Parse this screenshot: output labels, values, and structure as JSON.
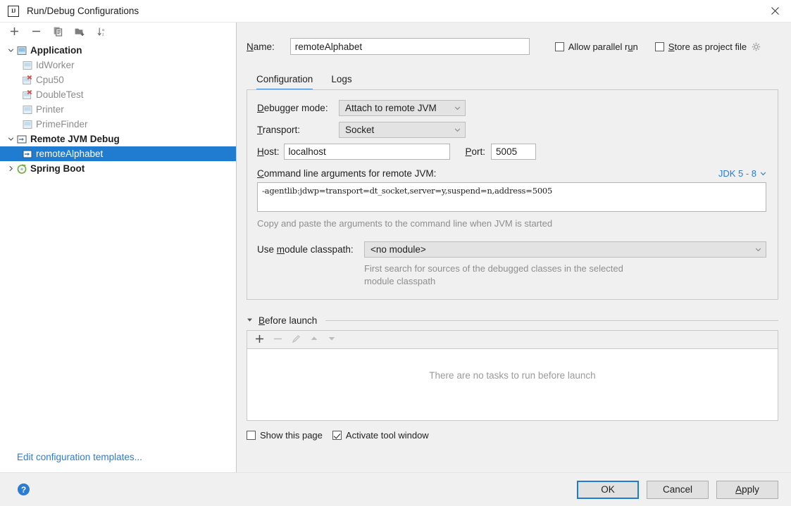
{
  "window": {
    "title": "Run/Debug Configurations",
    "app_icon": "IJ",
    "close_icon": "close-icon"
  },
  "tree_toolbar": {
    "items": [
      {
        "name": "add-configuration",
        "icon": "plus-icon"
      },
      {
        "name": "remove-configuration",
        "icon": "minus-icon"
      },
      {
        "name": "copy-configuration",
        "icon": "copy-icon"
      },
      {
        "name": "save-configuration",
        "icon": "folder-add-icon"
      },
      {
        "name": "sort-configurations",
        "icon": "sort-alpha-icon"
      }
    ]
  },
  "tree": {
    "nodes": [
      {
        "label": "Application",
        "level": 0,
        "bold": true,
        "muted": false,
        "selected": false,
        "expander": "expanded",
        "icon": "application-icon"
      },
      {
        "label": "IdWorker",
        "level": 1,
        "bold": false,
        "muted": true,
        "selected": false,
        "expander": "none",
        "icon": "application-icon"
      },
      {
        "label": "Cpu50",
        "level": 1,
        "bold": false,
        "muted": true,
        "selected": false,
        "expander": "none",
        "icon": "application-error-icon"
      },
      {
        "label": "DoubleTest",
        "level": 1,
        "bold": false,
        "muted": true,
        "selected": false,
        "expander": "none",
        "icon": "application-error-icon"
      },
      {
        "label": "Printer",
        "level": 1,
        "bold": false,
        "muted": true,
        "selected": false,
        "expander": "none",
        "icon": "application-icon"
      },
      {
        "label": "PrimeFinder",
        "level": 1,
        "bold": false,
        "muted": true,
        "selected": false,
        "expander": "none",
        "icon": "application-icon"
      },
      {
        "label": "Remote JVM Debug",
        "level": 0,
        "bold": true,
        "muted": false,
        "selected": false,
        "expander": "expanded",
        "icon": "remote-debug-icon"
      },
      {
        "label": "remoteAlphabet",
        "level": 1,
        "bold": false,
        "muted": false,
        "selected": true,
        "expander": "none",
        "icon": "remote-debug-icon"
      },
      {
        "label": "Spring Boot",
        "level": 0,
        "bold": true,
        "muted": false,
        "selected": false,
        "expander": "collapsed",
        "icon": "spring-boot-icon"
      }
    ],
    "edit_templates_link": "Edit configuration templates..."
  },
  "form": {
    "name_label": "Name:",
    "name_value": "remoteAlphabet",
    "name_placeholder": "",
    "allow_parallel_run": {
      "label": "Allow parallel run",
      "checked": false
    },
    "store_as_project_file": {
      "label": "Store as project file",
      "checked": false,
      "gear_icon": "gear-icon"
    }
  },
  "tabs": [
    {
      "label": "Configuration",
      "active": true
    },
    {
      "label": "Logs",
      "active": false
    }
  ],
  "configuration": {
    "debugger_mode_label": "Debugger mode:",
    "debugger_mode_value": "Attach to remote JVM",
    "transport_label": "Transport:",
    "transport_value": "Socket",
    "host_label": "Host:",
    "host_value": "localhost",
    "port_label": "Port:",
    "port_value": "5005",
    "cmd_args_label": "Command line arguments for remote JVM:",
    "jdk_selector": "JDK 5 - 8",
    "cmd_args_value": "-agentlib:jdwp=transport=dt_socket,server=y,suspend=n,address=5005",
    "copy_hint": "Copy and paste the arguments to the command line when JVM is started",
    "module_classpath_label": "Use module classpath:",
    "module_classpath_value": "<no module>",
    "module_hint_line1": "First search for sources of the debugged classes in the selected",
    "module_hint_line2": "module classpath"
  },
  "before_launch": {
    "title": "Before launch",
    "collapse_icon": "triangle-down-icon",
    "toolbar": [
      {
        "name": "add-task",
        "icon": "plus-icon",
        "enabled": true
      },
      {
        "name": "remove-task",
        "icon": "minus-icon",
        "enabled": false
      },
      {
        "name": "edit-task",
        "icon": "pencil-icon",
        "enabled": false
      },
      {
        "name": "move-task-up",
        "icon": "triangle-up-icon",
        "enabled": false
      },
      {
        "name": "move-task-down",
        "icon": "triangle-down-icon",
        "enabled": false
      }
    ],
    "empty_text": "There are no tasks to run before launch",
    "show_this_page": {
      "label": "Show this page",
      "checked": false
    },
    "activate_tool_window": {
      "label": "Activate tool window",
      "checked": true
    }
  },
  "footer": {
    "help_icon": "question-mark-icon",
    "buttons": [
      {
        "label": "OK",
        "primary": true
      },
      {
        "label": "Cancel",
        "primary": false
      },
      {
        "label": "Apply",
        "primary": false
      }
    ]
  },
  "colors": {
    "accent": "#2b7cd3",
    "selection": "#1f7cd0",
    "tab_underline": "#3d86d0",
    "error": "#d6504a",
    "background": "#f0f0f0",
    "panel": "#ffffff"
  }
}
